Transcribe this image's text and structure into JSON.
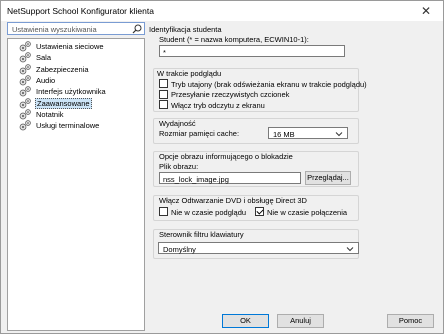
{
  "window": {
    "title": "NetSupport School Konfigurator klienta",
    "close_glyph": "✕"
  },
  "search": {
    "placeholder": "Ustawienia wyszukiwania"
  },
  "tree": {
    "items": [
      {
        "label": "Ustawienia sieciowe"
      },
      {
        "label": "Sala"
      },
      {
        "label": "Zabezpieczenia"
      },
      {
        "label": "Audio"
      },
      {
        "label": "Interfejs użytkownika"
      },
      {
        "label": "Zaawansowane",
        "selected": true
      },
      {
        "label": "Notatnik"
      },
      {
        "label": "Usługi terminalowe"
      }
    ]
  },
  "identification": {
    "title": "Identyfikacja studenta",
    "student_label": "Student (* = nazwa komputera, ECWIN10-1):",
    "student_value": "*"
  },
  "during_view": {
    "title": "W trakcie podglądu",
    "options": [
      {
        "label": "Tryb utajony (brak odświeżania ekranu w trakcie podglądu)",
        "checked": false
      },
      {
        "label": "Przesyłanie rzeczywistych czcionek",
        "checked": false
      },
      {
        "label": "Włącz tryb odczytu z ekranu",
        "checked": false
      }
    ]
  },
  "performance": {
    "title": "Wydajność",
    "cache_label": "Rozmiar pamięci cache:",
    "cache_value": "16 MB"
  },
  "lock_image": {
    "title": "Opcje obrazu informującego o blokadzie",
    "file_label": "Plik obrazu:",
    "file_value": "nss_lock_image.jpg",
    "browse_label": "Przeglądaj..."
  },
  "dvd": {
    "title": "Włącz Odtwarzanie DVD i obsługę Direct 3D",
    "options": [
      {
        "label": "Nie w czasie podglądu",
        "checked": false
      },
      {
        "label": "Nie w czasie połączenia",
        "checked": true
      }
    ]
  },
  "keyboard": {
    "title": "Sterownik filtru klawiatury",
    "value": "Domyślny"
  },
  "footer": {
    "ok_label": "OK",
    "cancel_label": "Anuluj",
    "help_label": "Pomoc"
  }
}
